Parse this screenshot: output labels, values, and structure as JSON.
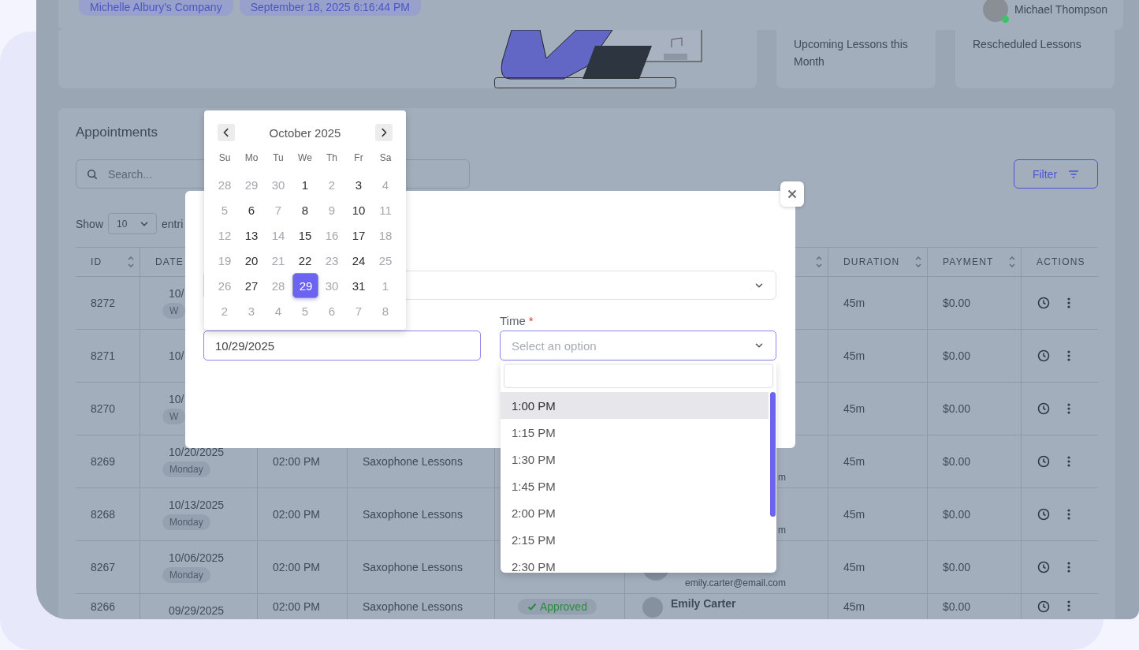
{
  "header": {
    "chips": [
      "Michelle Albury's Company",
      "September 18, 2025 6:16:44 PM"
    ],
    "user": {
      "name": "Michael Thompson",
      "online": true
    }
  },
  "stat_cards": [
    {
      "label": "Upcoming Lessons this Month"
    },
    {
      "label": "Rescheduled Lessons"
    }
  ],
  "appointments": {
    "title": "Appointments",
    "search": {
      "placeholder": "Search..."
    },
    "filter_button": "Filter",
    "show_label": "Show",
    "page_size": "10",
    "entries_label": "entri",
    "columns": [
      {
        "label": "ID",
        "sortable": true
      },
      {
        "label": "DATE",
        "sortable": false
      },
      {},
      {},
      {},
      {
        "sortable": true
      },
      {
        "label": "DURATION",
        "sortable": true
      },
      {
        "label": "PAYMENT",
        "sortable": true
      },
      {
        "label": "ACTIONS",
        "sortable": false
      }
    ],
    "rows": [
      {
        "id": "8272",
        "date": "10/",
        "day": "W",
        "duration": "45m",
        "payment": "$0.00"
      },
      {
        "id": "8271",
        "date": "10/",
        "duration": "45m",
        "payment": "$0.00"
      },
      {
        "id": "8270",
        "date": "10/",
        "day": "W",
        "duration": "45m",
        "payment": "$0.00"
      },
      {
        "id": "8269",
        "date": "10/20/2025",
        "day": "Monday",
        "time": "02:00 PM",
        "service": "Saxophone Lessons",
        "client_email": "m",
        "duration": "45m",
        "payment": "$0.00"
      },
      {
        "id": "8268",
        "date": "10/13/2025",
        "day": "Monday",
        "time": "02:00 PM",
        "service": "Saxophone Lessons",
        "client_email": "m",
        "duration": "45m",
        "payment": "$0.00"
      },
      {
        "id": "8267",
        "date": "10/06/2025",
        "day": "Monday",
        "time": "02:00 PM",
        "service": "Saxophone Lessons",
        "client_email": "emily.carter@email.com",
        "duration": "45m",
        "payment": "$0.00"
      },
      {
        "id": "8266",
        "date": "09/29/2025",
        "time": "02:00 PM",
        "service": "Saxophone Lessons",
        "status": "Approved",
        "client_name": "Emily Carter",
        "duration": "45m",
        "payment": "$0.00"
      }
    ]
  },
  "modal": {
    "date_field": {
      "value": "10/29/2025"
    },
    "time_field": {
      "label": "Time",
      "required_mark": "*",
      "placeholder": "Select an option"
    },
    "time_options": [
      {
        "label": "1:00 PM",
        "highlighted": true
      },
      {
        "label": "1:15 PM",
        "highlighted": false
      },
      {
        "label": "1:30 PM",
        "highlighted": false
      },
      {
        "label": "1:45 PM",
        "highlighted": false
      },
      {
        "label": "2:00 PM",
        "highlighted": false
      },
      {
        "label": "2:15 PM",
        "highlighted": false
      },
      {
        "label": "2:30 PM",
        "highlighted": false
      }
    ]
  },
  "datepicker": {
    "month": "October 2025",
    "weekdays": [
      "Su",
      "Mo",
      "Tu",
      "We",
      "Th",
      "Fr",
      "Sa"
    ],
    "weeks": [
      [
        {
          "day": "28",
          "disabled": true,
          "selected": false
        },
        {
          "day": "29",
          "disabled": true,
          "selected": false
        },
        {
          "day": "30",
          "disabled": true,
          "selected": false
        },
        {
          "day": "1",
          "disabled": false,
          "selected": false
        },
        {
          "day": "2",
          "disabled": true,
          "selected": false
        },
        {
          "day": "3",
          "disabled": false,
          "selected": false
        },
        {
          "day": "4",
          "disabled": true,
          "selected": false
        }
      ],
      [
        {
          "day": "5",
          "disabled": true,
          "selected": false
        },
        {
          "day": "6",
          "disabled": false,
          "selected": false
        },
        {
          "day": "7",
          "disabled": true,
          "selected": false
        },
        {
          "day": "8",
          "disabled": false,
          "selected": false
        },
        {
          "day": "9",
          "disabled": true,
          "selected": false
        },
        {
          "day": "10",
          "disabled": false,
          "selected": false
        },
        {
          "day": "11",
          "disabled": true,
          "selected": false
        }
      ],
      [
        {
          "day": "12",
          "disabled": true,
          "selected": false
        },
        {
          "day": "13",
          "disabled": false,
          "selected": false
        },
        {
          "day": "14",
          "disabled": true,
          "selected": false
        },
        {
          "day": "15",
          "disabled": false,
          "selected": false
        },
        {
          "day": "16",
          "disabled": true,
          "selected": false
        },
        {
          "day": "17",
          "disabled": false,
          "selected": false
        },
        {
          "day": "18",
          "disabled": true,
          "selected": false
        }
      ],
      [
        {
          "day": "19",
          "disabled": true,
          "selected": false
        },
        {
          "day": "20",
          "disabled": false,
          "selected": false
        },
        {
          "day": "21",
          "disabled": true,
          "selected": false
        },
        {
          "day": "22",
          "disabled": false,
          "selected": false
        },
        {
          "day": "23",
          "disabled": true,
          "selected": false
        },
        {
          "day": "24",
          "disabled": false,
          "selected": false
        },
        {
          "day": "25",
          "disabled": true,
          "selected": false
        }
      ],
      [
        {
          "day": "26",
          "disabled": true,
          "selected": false
        },
        {
          "day": "27",
          "disabled": false,
          "selected": false
        },
        {
          "day": "28",
          "disabled": true,
          "selected": false
        },
        {
          "day": "29",
          "disabled": false,
          "selected": true
        },
        {
          "day": "30",
          "disabled": true,
          "selected": false
        },
        {
          "day": "31",
          "disabled": false,
          "selected": false
        },
        {
          "day": "1",
          "disabled": true,
          "selected": false
        }
      ],
      [
        {
          "day": "2",
          "disabled": true,
          "selected": false
        },
        {
          "day": "3",
          "disabled": true,
          "selected": false
        },
        {
          "day": "4",
          "disabled": true,
          "selected": false
        },
        {
          "day": "5",
          "disabled": true,
          "selected": false
        },
        {
          "day": "6",
          "disabled": true,
          "selected": false
        },
        {
          "day": "7",
          "disabled": true,
          "selected": false
        },
        {
          "day": "8",
          "disabled": true,
          "selected": false
        }
      ]
    ]
  }
}
